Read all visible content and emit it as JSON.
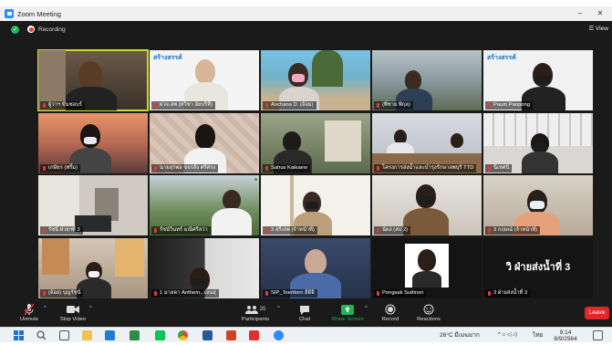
{
  "window": {
    "title": "Zoom Meeting",
    "minimize": "–",
    "close": "✕"
  },
  "recording": {
    "label": "Recording",
    "view_label": "View"
  },
  "participants": [
    {
      "name": "ผู้ว่าฯ ขันชอบร์",
      "active": true
    },
    {
      "name": "ผวจ.ลพ (ทวิชา อัยบริทิ์)"
    },
    {
      "name": "Anchana D. (อ้อม)"
    },
    {
      "name": "(พี่ชาย พิกุล)"
    },
    {
      "name": "Paum Panpong"
    },
    {
      "name": "เกษียร (พริ้ม)"
    },
    {
      "name": "นายสุรพล ขจรสัง ศรีศรง"
    },
    {
      "name": "Sahus Kaikaew"
    },
    {
      "name": "โครงการส่งน้ำและบำรุงรักษาลพบุรี TTD"
    },
    {
      "name": "นิเทศนี"
    },
    {
      "name": "รัชนี ฝ่ายฯที่ 3"
    },
    {
      "name": "รัชนัวินทร์ มณีศรีสว่า"
    },
    {
      "name": "3 สุรีเสพ (จ้าหน้าที่)"
    },
    {
      "name": "นัดง่ (ลบ 2)"
    },
    {
      "name": "3 กฤษณ์ (จ้าหน้าที่)"
    },
    {
      "name": "(อ้อย) บุญรัชนี"
    },
    {
      "name": "1 มาลดา Anthem...เจนสุ"
    },
    {
      "name": "SIP_Teerttorn อีดีอิ"
    },
    {
      "name": "Pongsak Suttinon"
    },
    {
      "name": "3 ฝ่ายส่งน้ำที่ 3"
    }
  ],
  "slide_tile_text": "วิ ฝ่ายส่งน้ำที่ 3",
  "logo_text": "สร้างสรรค์",
  "logo_sub": "View",
  "toolbar": {
    "unmute": "Unmute",
    "stop_video": "Stop Video",
    "participants": "Participants",
    "participants_count": "20",
    "chat": "Chat",
    "share_screen": "Share Screen",
    "record": "Record",
    "reactions": "Reactions",
    "leave": "Leave"
  },
  "taskbar": {
    "weather": "26°C  มีเมฆมาก",
    "lang": "ไทย",
    "time": "9:14",
    "date": "8/9/2564"
  },
  "colors": {
    "share_green": "#23b35a",
    "leave_red": "#e02828",
    "active_speaker": "#c8dc2e",
    "zoom_blue": "#2d8cff"
  }
}
